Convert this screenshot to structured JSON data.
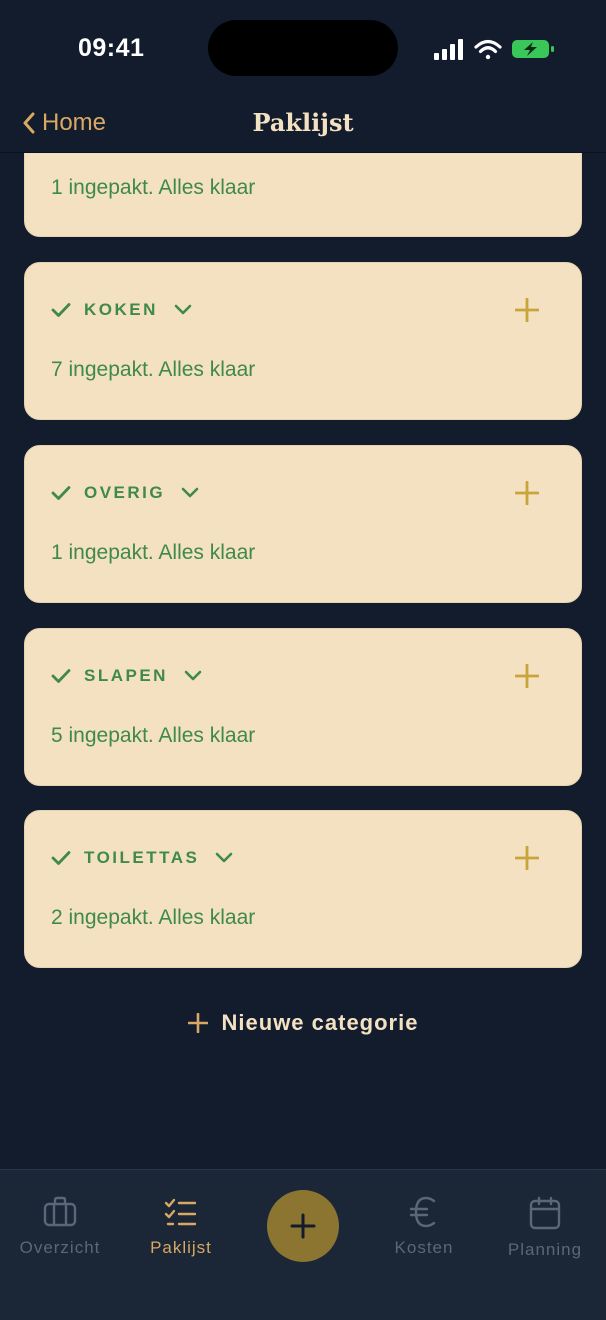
{
  "status_bar": {
    "time": "09:41",
    "battery_color": "#3ac75a"
  },
  "nav": {
    "back_label": "Home",
    "title": "Paklijst"
  },
  "categories": [
    {
      "name": "",
      "summary": "1 ingepakt. Alles klaar",
      "partial": true
    },
    {
      "name": "KOKEN",
      "summary": "7 ingepakt. Alles klaar"
    },
    {
      "name": "OVERIG",
      "summary": "1 ingepakt. Alles klaar"
    },
    {
      "name": "SLAPEN",
      "summary": "5 ingepakt. Alles klaar"
    },
    {
      "name": "TOILETTAS",
      "summary": "2 ingepakt. Alles klaar"
    }
  ],
  "new_category_label": "Nieuwe categorie",
  "tabs": [
    {
      "label": "Overzicht",
      "icon": "briefcase-icon",
      "active": false
    },
    {
      "label": "Paklijst",
      "icon": "checklist-icon",
      "active": true
    },
    {
      "label": "",
      "icon": "plus-icon",
      "fab": true
    },
    {
      "label": "Kosten",
      "icon": "euro-icon",
      "active": false
    },
    {
      "label": "Planning",
      "icon": "calendar-icon",
      "active": false
    }
  ],
  "colors": {
    "background": "#121c2c",
    "card": "#f3e1c2",
    "accent_green": "#3f8a47",
    "accent_gold": "#d9a864",
    "add_icon": "#c9a43a",
    "fab": "#8b7531"
  }
}
